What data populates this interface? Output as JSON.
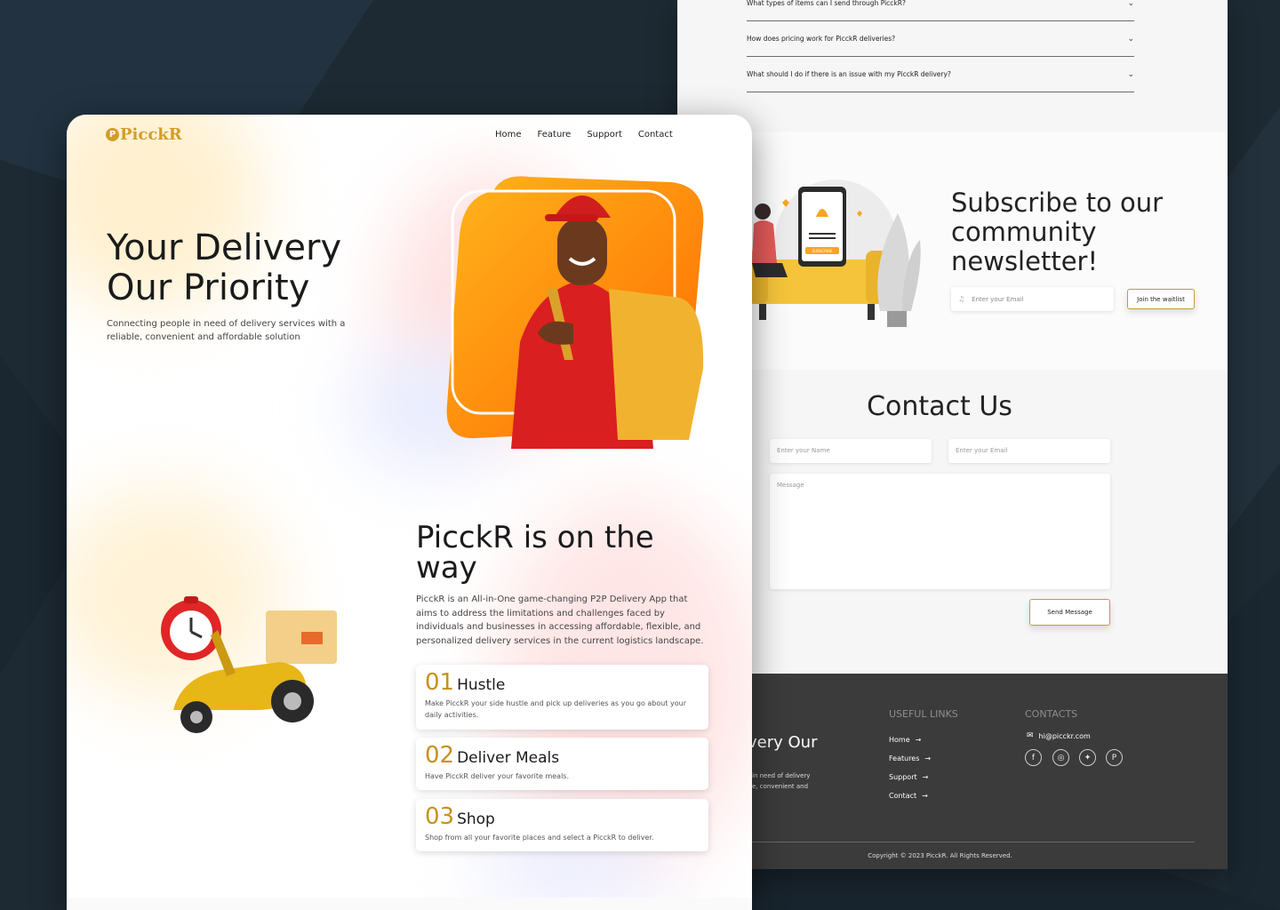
{
  "faq": {
    "items": [
      {
        "question": "What types of items can I send through PicckR?",
        "chevron": "chevron-down-icon"
      },
      {
        "question": "How does pricing work for PicckR deliveries?",
        "chevron": "chevron-down-icon"
      },
      {
        "question": "What should I do if there is an issue with my PicckR delivery?",
        "chevron": "chevron-down-icon"
      }
    ]
  },
  "subscribe": {
    "title": "Subscribe to our community newsletter!",
    "email_placeholder": "Enter your Email",
    "button": "Join the waitlist",
    "illustration_button": "SUBSCRIBE"
  },
  "contact": {
    "title": "Contact Us",
    "name_placeholder": "Enter your Name",
    "email_placeholder": "Enter your Email",
    "message_placeholder": "Message",
    "send_button": "Send Message"
  },
  "footer": {
    "partial_title": "ivery Our",
    "partial_text_1": "in need of delivery",
    "partial_text_2": "e, convenient and",
    "useful_links_heading": "USEFUL LINKS",
    "links": [
      "Home",
      "Features",
      "Support",
      "Contact"
    ],
    "contacts_heading": "CONTACTS",
    "email": "hi@picckr.com",
    "social": [
      "facebook-icon",
      "instagram-icon",
      "twitter-icon",
      "pinterest-icon"
    ],
    "copyright": "Copyright © 2023 PicckR. All Rights Reserved."
  },
  "header": {
    "logo": "PicckR",
    "logo_mark": "P",
    "nav": [
      "Home",
      "Feature",
      "Support",
      "Contact"
    ]
  },
  "hero": {
    "title_line1": "Your Delivery",
    "title_line2": "Our Priority",
    "subtitle": "Connecting people in need of delivery services with a reliable, convenient and affordable solution"
  },
  "about": {
    "title": "PicckR is on the way",
    "text": "PicckR is an All-in-One game-changing P2P Delivery App that aims to address the limitations and challenges faced by individuals and businesses in accessing affordable, flexible, and personalized delivery services in the current logistics landscape.",
    "cards": [
      {
        "num": "01",
        "title": "Hustle",
        "desc": "Make PicckR your side hustle and pick up deliveries as you go about your daily activities."
      },
      {
        "num": "02",
        "title": "Deliver Meals",
        "desc": "Have PicckR deliver your favorite meals."
      },
      {
        "num": "03",
        "title": "Shop",
        "desc": "Shop from all your favorite places and select a PicckR to deliver."
      }
    ]
  },
  "colors": {
    "brand_gold": "#d39d2a",
    "accent_orange": "#f28c0f",
    "dark_bg": "#1d2a33",
    "footer_bg": "#3b3b3b"
  }
}
